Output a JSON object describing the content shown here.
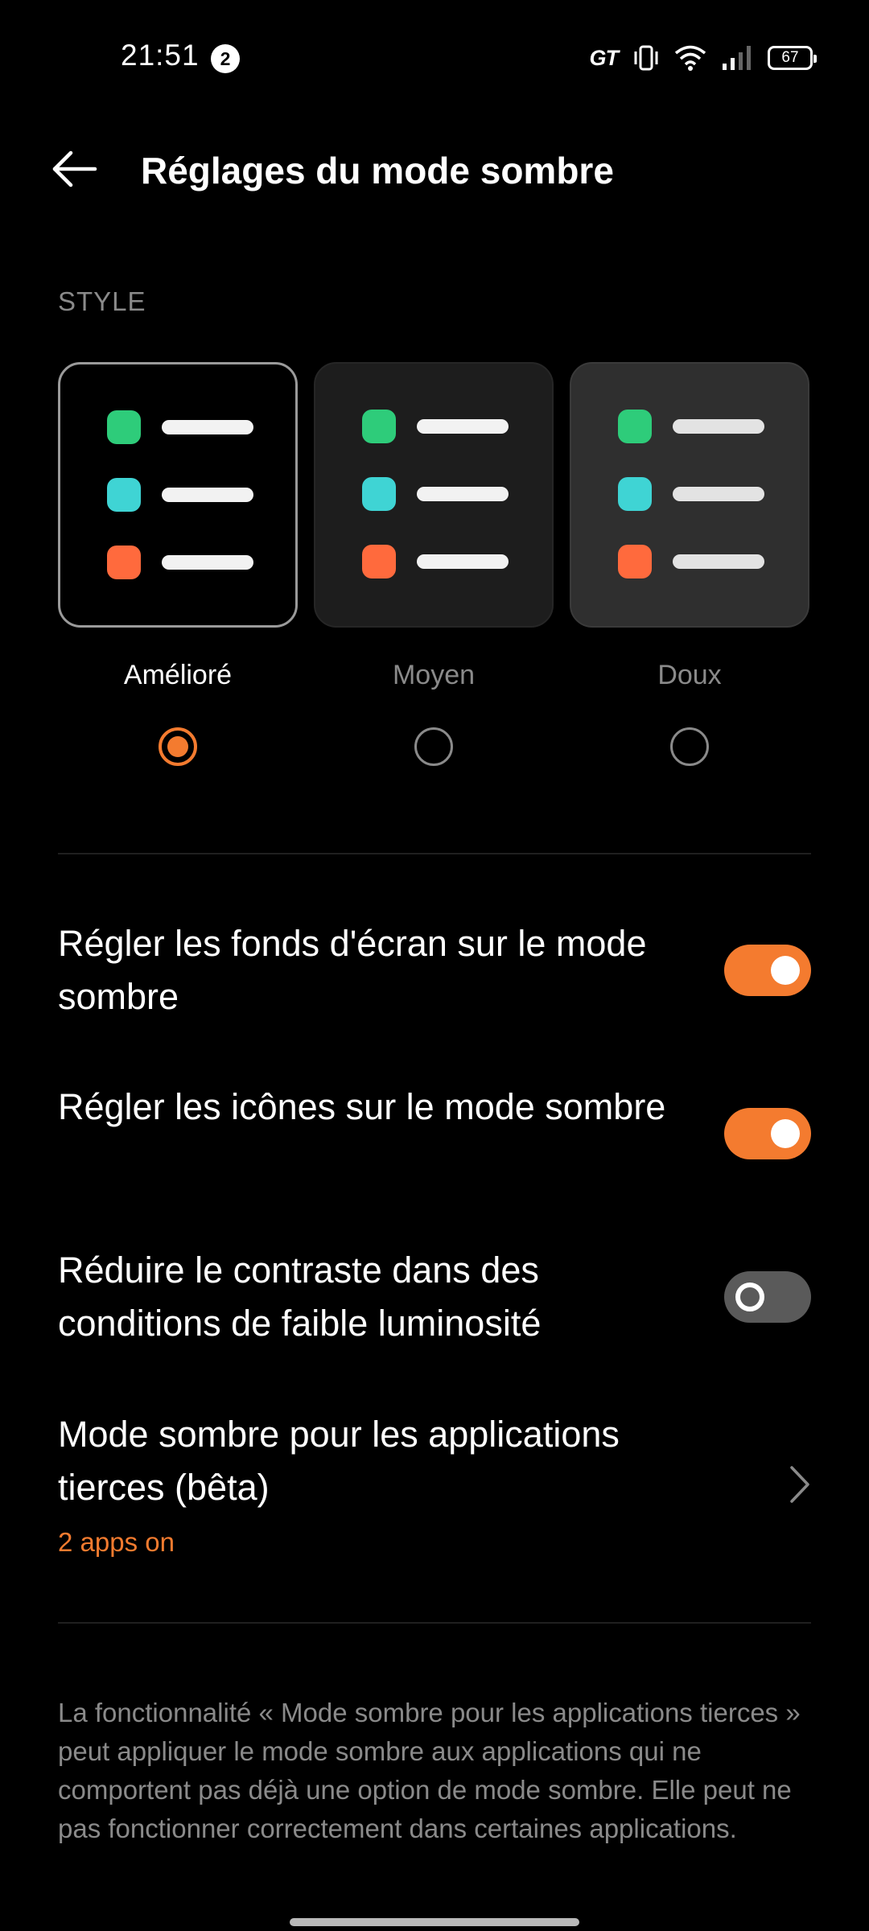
{
  "status_bar": {
    "time": "21:51",
    "notification_count": "2",
    "network_label": "GT",
    "battery": "67",
    "icons": [
      "vibrate-icon",
      "wifi-icon",
      "signal-icon",
      "battery-icon"
    ]
  },
  "header": {
    "title": "Réglages du mode sombre",
    "back_icon": "back-arrow-icon"
  },
  "style_section": {
    "label": "STYLE",
    "options": [
      {
        "label": "Amélioré",
        "selected": true
      },
      {
        "label": "Moyen",
        "selected": false
      },
      {
        "label": "Doux",
        "selected": false
      }
    ],
    "dot_colors": [
      "#2ecc7a",
      "#3fd4d4",
      "#ff6a3d"
    ]
  },
  "settings": [
    {
      "label": "Régler les fonds d'écran sur le mode sombre",
      "enabled": true
    },
    {
      "label": "Régler les icônes sur le mode sombre",
      "enabled": true
    },
    {
      "label": "Réduire le contraste dans des conditions de faible luminosité",
      "enabled": false
    }
  ],
  "third_party": {
    "label": "Mode sombre pour les applications tierces (bêta)",
    "status": "2 apps on"
  },
  "footnote": "La fonctionnalité « Mode sombre pour les applications tierces » peut appliquer le mode sombre aux applications qui ne comportent pas déjà une option de mode sombre. Elle peut ne pas fonctionner correctement dans certaines applications.",
  "colors": {
    "accent": "#f47b2f",
    "background": "#000000",
    "secondary_text": "#8a8a8a"
  }
}
